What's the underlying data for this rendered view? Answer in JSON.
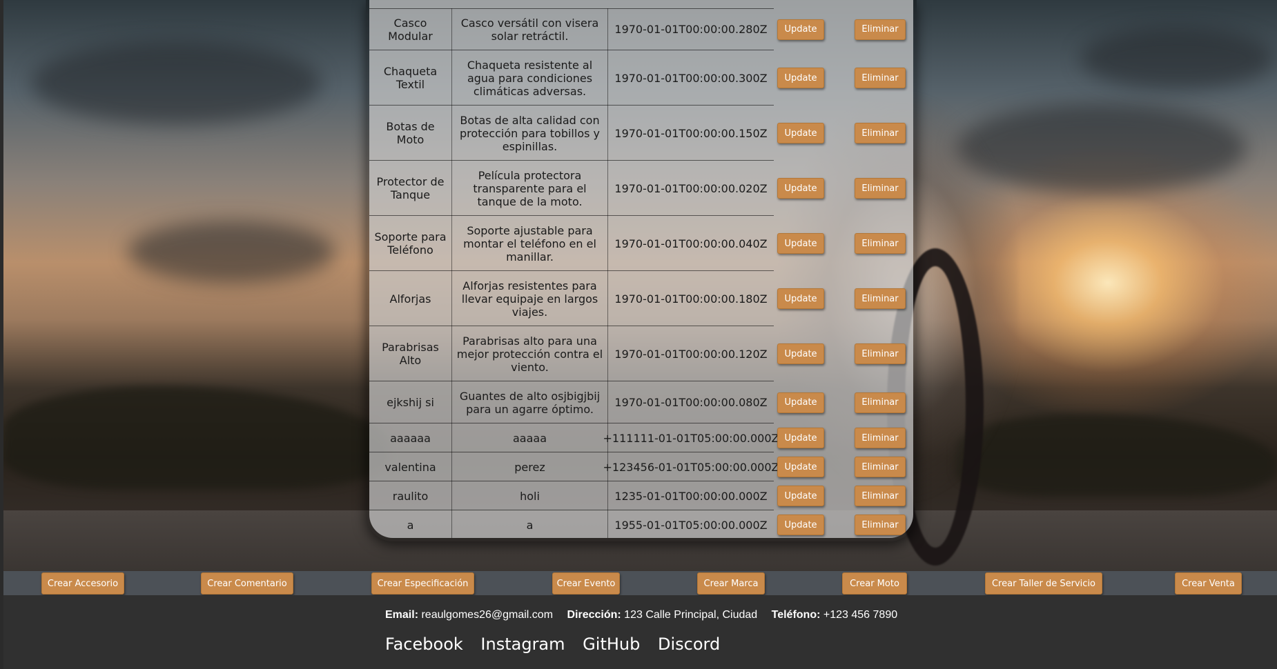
{
  "table": {
    "rows": [
      {
        "name": "Casco Modular",
        "description": "Casco versátil con visera solar retráctil.",
        "date": "1970-01-01T00:00:00.280Z",
        "update_label": "Update",
        "delete_label": "Eliminar"
      },
      {
        "name": "Chaqueta Textil",
        "description": "Chaqueta resistente al agua para condiciones climáticas adversas.",
        "date": "1970-01-01T00:00:00.300Z",
        "update_label": "Update",
        "delete_label": "Eliminar"
      },
      {
        "name": "Botas de Moto",
        "description": "Botas de alta calidad con protección para tobillos y espinillas.",
        "date": "1970-01-01T00:00:00.150Z",
        "update_label": "Update",
        "delete_label": "Eliminar"
      },
      {
        "name": "Protector de Tanque",
        "description": "Película protectora transparente para el tanque de la moto.",
        "date": "1970-01-01T00:00:00.020Z",
        "update_label": "Update",
        "delete_label": "Eliminar"
      },
      {
        "name": "Soporte para Teléfono",
        "description": "Soporte ajustable para montar el teléfono en el manillar.",
        "date": "1970-01-01T00:00:00.040Z",
        "update_label": "Update",
        "delete_label": "Eliminar"
      },
      {
        "name": "Alforjas",
        "description": "Alforjas resistentes para llevar equipaje en largos viajes.",
        "date": "1970-01-01T00:00:00.180Z",
        "update_label": "Update",
        "delete_label": "Eliminar"
      },
      {
        "name": "Parabrisas Alto",
        "description": "Parabrisas alto para una mejor protección contra el viento.",
        "date": "1970-01-01T00:00:00.120Z",
        "update_label": "Update",
        "delete_label": "Eliminar"
      },
      {
        "name": "ejkshij si",
        "description": "Guantes de alto osjbigjbij para un agarre óptimo.",
        "date": "1970-01-01T00:00:00.080Z",
        "update_label": "Update",
        "delete_label": "Eliminar"
      },
      {
        "name": "aaaaaa",
        "description": "aaaaa",
        "date": "+111111-01-01T05:00:00.000Z",
        "update_label": "Update",
        "delete_label": "Eliminar"
      },
      {
        "name": "valentina",
        "description": "perez",
        "date": "+123456-01-01T05:00:00.000Z",
        "update_label": "Update",
        "delete_label": "Eliminar"
      },
      {
        "name": "raulito",
        "description": "holi",
        "date": "1235-01-01T00:00:00.000Z",
        "update_label": "Update",
        "delete_label": "Eliminar"
      },
      {
        "name": "a",
        "description": "a",
        "date": "1955-01-01T05:00:00.000Z",
        "update_label": "Update",
        "delete_label": "Eliminar"
      }
    ]
  },
  "nav": {
    "crear_accesorio": "Crear Accesorio",
    "crear_comentario": "Crear Comentario",
    "crear_especificacion": "Crear Especificación",
    "crear_evento": "Crear Evento",
    "crear_marca": "Crear Marca",
    "crear_moto": "Crear Moto",
    "crear_taller": "Crear Taller de Servicio",
    "crear_venta": "Crear Venta"
  },
  "footer": {
    "email_label": "Email:",
    "email_value": "reaulgomes26@gmail.com",
    "address_label": "Dirección:",
    "address_value": "123 Calle Principal, Ciudad",
    "phone_label": "Teléfono:",
    "phone_value": "+123 456 7890",
    "social": [
      "Facebook",
      "Instagram",
      "GitHub",
      "Discord"
    ]
  },
  "colors": {
    "button": "#c98a4b",
    "navbar": "#4c5157",
    "footer": "#303030"
  }
}
